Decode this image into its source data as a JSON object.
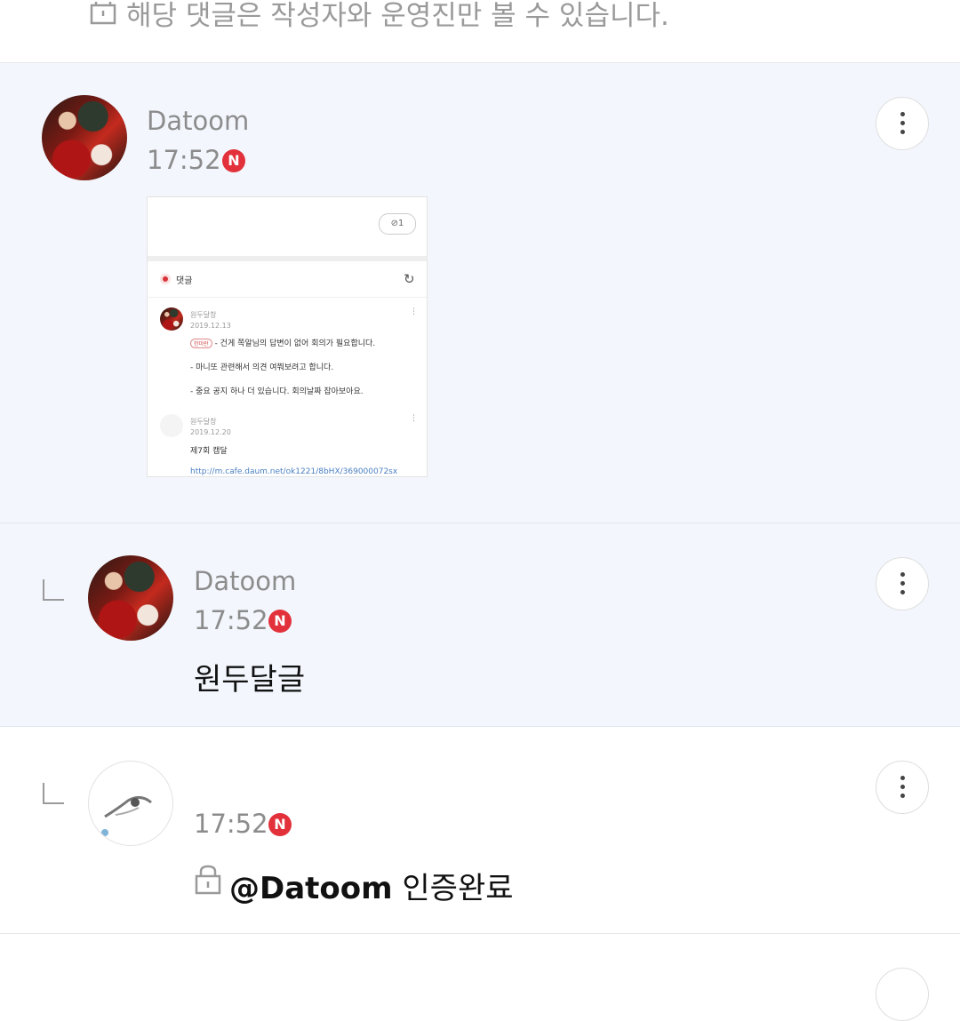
{
  "top_notice": {
    "text": "해당 댓글은 작성자와 운영진만 볼 수 있습니다."
  },
  "comments": [
    {
      "author": "Datoom",
      "time": "17:52",
      "new_badge": "N",
      "attachment": {
        "pill": "1",
        "header": "댓글",
        "entries": [
          {
            "author": "원두달창",
            "date": "2019.12.13",
            "tag": "한미란",
            "lines": [
              "- 건게 쪽알님의 답변이 없어 회의가 필요합니다.",
              "- 마니또 관련해서 의견 여쭤보려고 합니다.",
              "- 중요 공지 하나 더 있습니다. 회의날짜 잡아보아요."
            ]
          },
          {
            "author": "원두달창",
            "date": "2019.12.20",
            "lines": [
              "제7회 캠달"
            ],
            "link": "http://m.cafe.daum.net/ok1221/8bHX/369000072sx"
          }
        ]
      }
    },
    {
      "author": "Datoom",
      "time": "17:52",
      "new_badge": "N",
      "text": "원두달글"
    },
    {
      "time": "17:52",
      "new_badge": "N",
      "mention": "@Datoom",
      "text": "인증완료"
    }
  ]
}
